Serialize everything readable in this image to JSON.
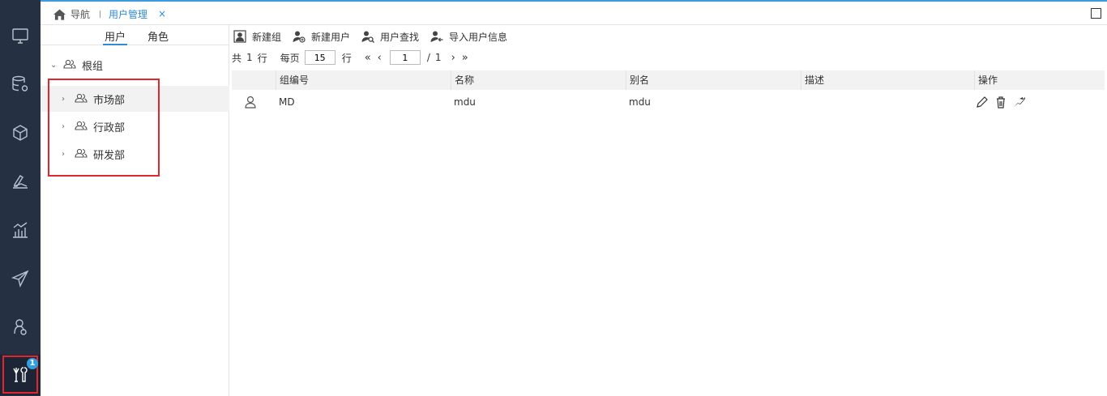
{
  "tabs": {
    "home_label": "导航",
    "active_label": "用户管理",
    "close_glyph": "×"
  },
  "rail": {
    "badge": "1",
    "items": [
      "monitor-icon",
      "database-gear-icon",
      "cube-icon",
      "layers-edit-icon",
      "bar-chart-icon",
      "paper-plane-icon",
      "person-gear-icon",
      "tools-icon"
    ]
  },
  "tree": {
    "subtab_users": "用户",
    "subtab_roles": "角色",
    "root": "根组",
    "children": [
      "市场部",
      "行政部",
      "研发部"
    ]
  },
  "toolbar": {
    "new_group": "新建组",
    "new_user": "新建用户",
    "find_user": "用户查找",
    "import_users": "导入用户信息"
  },
  "pager": {
    "total_prefix": "共",
    "total_rows": "1",
    "rows_unit": "行",
    "per_page_label": "每页",
    "per_page_value": "15",
    "per_page_unit": "行",
    "current_page": "1",
    "page_sep": "/",
    "total_pages": "1"
  },
  "table": {
    "columns": [
      "组编号",
      "名称",
      "别名",
      "描述",
      "操作"
    ],
    "rows": [
      {
        "group_no": "MD",
        "name": "mdu",
        "alias": "mdu",
        "desc": ""
      }
    ]
  },
  "colors": {
    "rail_bg": "#253043",
    "accent": "#2f8bd4",
    "highlight": "#e3262b"
  }
}
